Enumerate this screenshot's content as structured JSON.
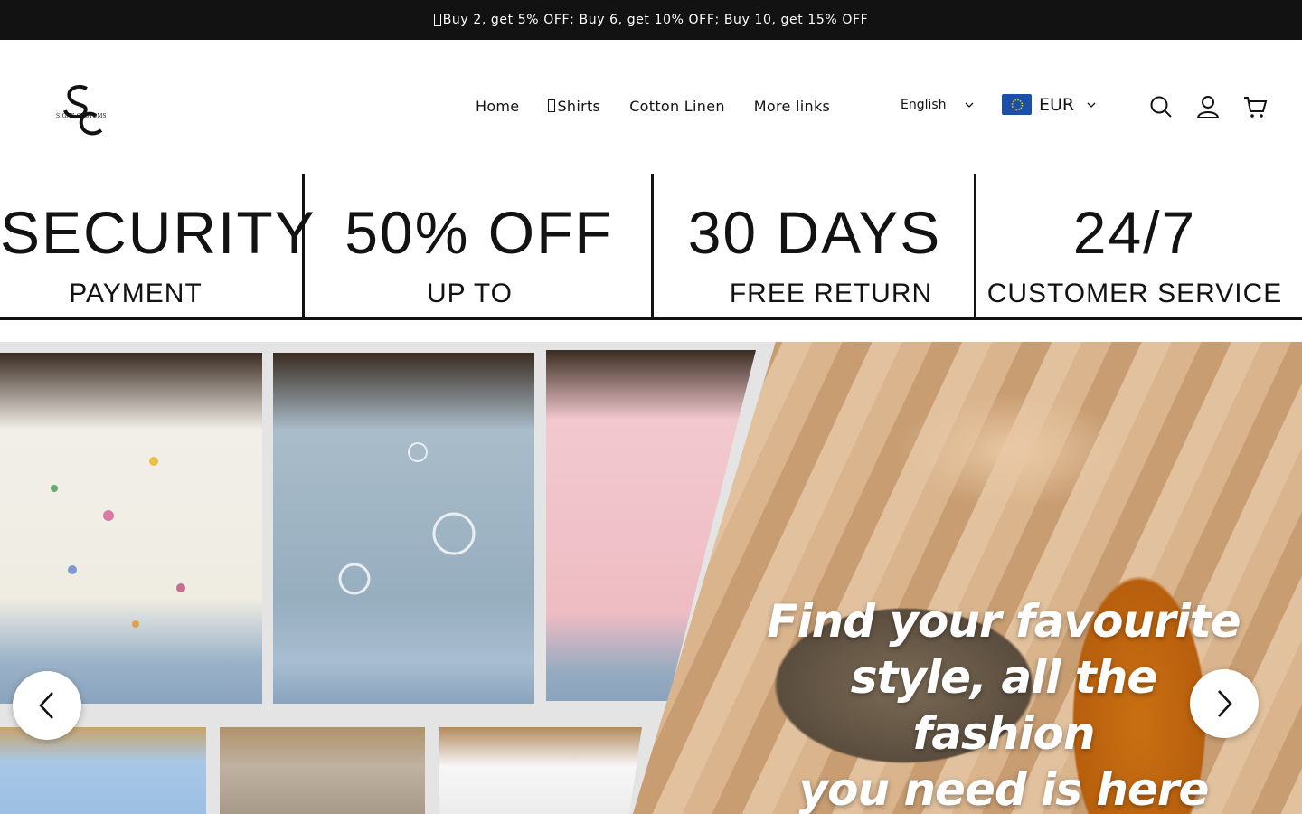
{
  "announcement": {
    "text": "Buy 2, get 5% OFF; Buy 6, get 10% OFF; Buy 10, get 15% OFF",
    "icon": "gift-icon"
  },
  "header": {
    "logo_text": "SIGNS CUSTOMS",
    "nav": [
      {
        "label": "Home"
      },
      {
        "label": "Shirts",
        "icon": "shirt-icon"
      },
      {
        "label": "Cotton Linen"
      },
      {
        "label": "More links"
      }
    ],
    "language": "English",
    "currency": "EUR",
    "icons": [
      "search-icon",
      "account-icon",
      "cart-icon"
    ]
  },
  "features": [
    {
      "big": "SECURITY",
      "small": "PAYMENT"
    },
    {
      "big": "50% OFF",
      "small": "UP TO"
    },
    {
      "big": "30 DAYS",
      "small": "FREE RETURN"
    },
    {
      "big": "24/7",
      "small": "CUSTOMER SERVICE"
    }
  ],
  "hero": {
    "caption_line1": "Find your favourite",
    "caption_line2": "style, all the fashion",
    "caption_line3": "you need is here"
  },
  "colors": {
    "dark": "#121212",
    "flag_blue": "#1c4fa6",
    "flag_stars": "#f5d000"
  }
}
